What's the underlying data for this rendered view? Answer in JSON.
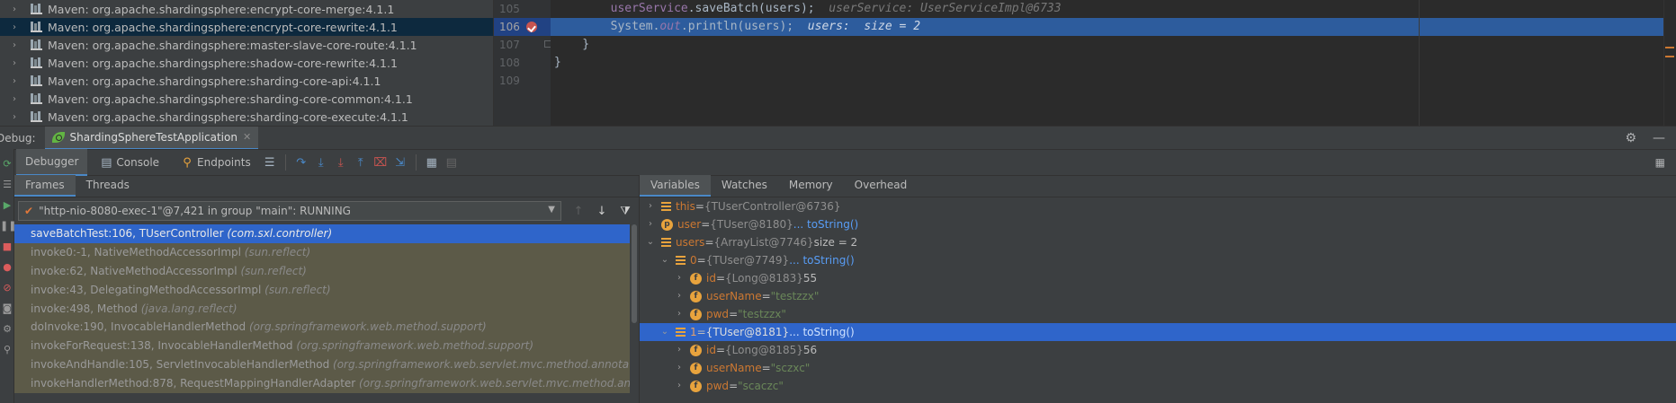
{
  "project_tree": {
    "items": [
      {
        "label": "Maven: org.apache.shardingsphere:encrypt-core-merge:4.1.1",
        "selected": false
      },
      {
        "label": "Maven: org.apache.shardingsphere:encrypt-core-rewrite:4.1.1",
        "selected": true
      },
      {
        "label": "Maven: org.apache.shardingsphere:master-slave-core-route:4.1.1",
        "selected": false
      },
      {
        "label": "Maven: org.apache.shardingsphere:shadow-core-rewrite:4.1.1",
        "selected": false
      },
      {
        "label": "Maven: org.apache.shardingsphere:sharding-core-api:4.1.1",
        "selected": false
      },
      {
        "label": "Maven: org.apache.shardingsphere:sharding-core-common:4.1.1",
        "selected": false
      },
      {
        "label": "Maven: org.apache.shardingsphere:sharding-core-execute:4.1.1",
        "selected": false
      }
    ]
  },
  "editor": {
    "line_numbers": [
      "105",
      "106",
      "107",
      "108",
      "109"
    ],
    "lines": [
      {
        "code_a": "userService",
        "code_b": ".saveBatch(users);",
        "hint": "  userService: UserServiceImpl@6733"
      },
      {
        "code_a": "System.",
        "code_it": "out",
        "code_b": ".println(users);",
        "hint": "  users:  size = 2"
      },
      {
        "code": "    }"
      },
      {
        "code": "}"
      },
      {
        "code": ""
      }
    ]
  },
  "debug": {
    "label": "Debug:",
    "session_tab": "ShardingSphereTestApplication",
    "toolbar_tabs": [
      "Debugger",
      "Console",
      "Endpoints"
    ],
    "frames_tabs": [
      "Frames",
      "Threads"
    ],
    "thread_selector": "\"http-nio-8080-exec-1\"@7,421 in group \"main\": RUNNING",
    "frames": [
      {
        "method": "saveBatchTest:106, TUserController",
        "pkg": "(com.sxl.controller)",
        "selected": true
      },
      {
        "method": "invoke0:-1, NativeMethodAccessorImpl",
        "pkg": "(sun.reflect)"
      },
      {
        "method": "invoke:62, NativeMethodAccessorImpl",
        "pkg": "(sun.reflect)"
      },
      {
        "method": "invoke:43, DelegatingMethodAccessorImpl",
        "pkg": "(sun.reflect)"
      },
      {
        "method": "invoke:498, Method",
        "pkg": "(java.lang.reflect)"
      },
      {
        "method": "doInvoke:190, InvocableHandlerMethod",
        "pkg": "(org.springframework.web.method.support)"
      },
      {
        "method": "invokeForRequest:138, InvocableHandlerMethod",
        "pkg": "(org.springframework.web.method.support)"
      },
      {
        "method": "invokeAndHandle:105, ServletInvocableHandlerMethod",
        "pkg": "(org.springframework.web.servlet.mvc.method.annotation)"
      },
      {
        "method": "invokeHandlerMethod:878, RequestMappingHandlerAdapter",
        "pkg": "(org.springframework.web.servlet.mvc.method.annota"
      }
    ],
    "vars_tabs": [
      "Variables",
      "Watches",
      "Memory",
      "Overhead"
    ],
    "variables": [
      {
        "indent": 0,
        "twisty": "›",
        "icon": "list",
        "name": "this",
        "eq": " = ",
        "type": "{TUserController@6736}",
        "link": "",
        "extra": ""
      },
      {
        "indent": 0,
        "twisty": "›",
        "icon": "p",
        "name": "user",
        "eq": " = ",
        "type": "{TUser@8180}",
        "link": " ... toString()",
        "extra": ""
      },
      {
        "indent": 0,
        "twisty": "⌄",
        "icon": "list",
        "name": "users",
        "eq": " = ",
        "type": "{ArrayList@7746}",
        "link": "",
        "extra": "  size = 2"
      },
      {
        "indent": 1,
        "twisty": "⌄",
        "icon": "list",
        "name": "0",
        "eq": " = ",
        "type": "{TUser@7749}",
        "link": " ... toString()",
        "extra": ""
      },
      {
        "indent": 2,
        "twisty": "›",
        "icon": "f",
        "name": "id",
        "eq": " = ",
        "type": "{Long@8183}",
        "link": "",
        "extra": " 55"
      },
      {
        "indent": 2,
        "twisty": "›",
        "icon": "f",
        "name": "userName",
        "eq": " = ",
        "type": "",
        "link": "",
        "extra": "",
        "str": "\"testzzx\""
      },
      {
        "indent": 2,
        "twisty": "›",
        "icon": "f",
        "name": "pwd",
        "eq": " = ",
        "type": "",
        "link": "",
        "extra": "",
        "str": "\"testzzx\""
      },
      {
        "indent": 1,
        "twisty": "⌄",
        "icon": "list",
        "name": "1",
        "eq": " = ",
        "type": "{TUser@8181}",
        "link": " ... toString()",
        "extra": "",
        "selected": true
      },
      {
        "indent": 2,
        "twisty": "›",
        "icon": "f",
        "name": "id",
        "eq": " = ",
        "type": "{Long@8185}",
        "link": "",
        "extra": " 56"
      },
      {
        "indent": 2,
        "twisty": "›",
        "icon": "f",
        "name": "userName",
        "eq": " = ",
        "type": "",
        "link": "",
        "extra": "",
        "str": "\"sczxc\""
      },
      {
        "indent": 2,
        "twisty": "›",
        "icon": "f",
        "name": "pwd",
        "eq": " = ",
        "type": "",
        "link": "",
        "extra": "",
        "str": "\"scaczc\""
      }
    ]
  }
}
